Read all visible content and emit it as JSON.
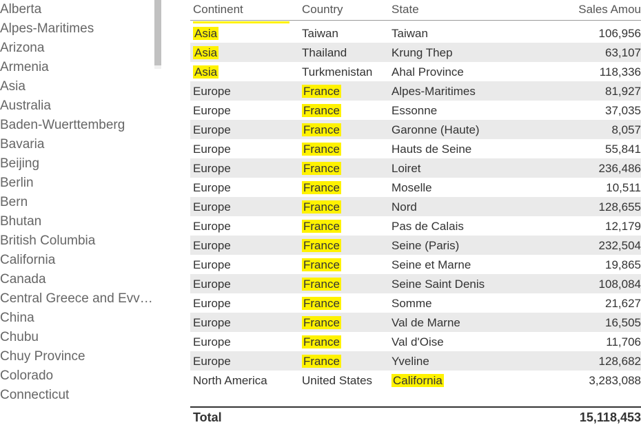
{
  "sidebar": {
    "items": [
      {
        "label": "Alberta"
      },
      {
        "label": "Alpes-Maritimes"
      },
      {
        "label": "Arizona"
      },
      {
        "label": "Armenia"
      },
      {
        "label": "Asia"
      },
      {
        "label": "Australia"
      },
      {
        "label": "Baden-Wuerttemberg"
      },
      {
        "label": "Bavaria"
      },
      {
        "label": "Beijing"
      },
      {
        "label": "Berlin"
      },
      {
        "label": "Bern"
      },
      {
        "label": "Bhutan"
      },
      {
        "label": "British Columbia"
      },
      {
        "label": "California"
      },
      {
        "label": "Canada"
      },
      {
        "label": "Central Greece and Evv…"
      },
      {
        "label": "China"
      },
      {
        "label": "Chubu"
      },
      {
        "label": "Chuy Province"
      },
      {
        "label": "Colorado"
      },
      {
        "label": "Connecticut"
      }
    ]
  },
  "table": {
    "headers": {
      "continent": "Continent",
      "country": "Country",
      "state": "State",
      "amount": "Sales Amou"
    },
    "rows": [
      {
        "continent": "Asia",
        "country": "Taiwan",
        "state": "Taiwan",
        "amount": "106,956",
        "h": "continent"
      },
      {
        "continent": "Asia",
        "country": "Thailand",
        "state": "Krung Thep",
        "amount": "63,107",
        "h": "continent"
      },
      {
        "continent": "Asia",
        "country": "Turkmenistan",
        "state": "Ahal Province",
        "amount": "118,336",
        "h": "continent"
      },
      {
        "continent": "Europe",
        "country": "France",
        "state": "Alpes-Maritimes",
        "amount": "81,927",
        "h": "country"
      },
      {
        "continent": "Europe",
        "country": "France",
        "state": "Essonne",
        "amount": "37,035",
        "h": "country"
      },
      {
        "continent": "Europe",
        "country": "France",
        "state": "Garonne (Haute)",
        "amount": "8,057",
        "h": "country"
      },
      {
        "continent": "Europe",
        "country": "France",
        "state": "Hauts de Seine",
        "amount": "55,841",
        "h": "country"
      },
      {
        "continent": "Europe",
        "country": "France",
        "state": "Loiret",
        "amount": "236,486",
        "h": "country"
      },
      {
        "continent": "Europe",
        "country": "France",
        "state": "Moselle",
        "amount": "10,511",
        "h": "country"
      },
      {
        "continent": "Europe",
        "country": "France",
        "state": "Nord",
        "amount": "128,655",
        "h": "country"
      },
      {
        "continent": "Europe",
        "country": "France",
        "state": "Pas de Calais",
        "amount": "12,179",
        "h": "country"
      },
      {
        "continent": "Europe",
        "country": "France",
        "state": "Seine (Paris)",
        "amount": "232,504",
        "h": "country"
      },
      {
        "continent": "Europe",
        "country": "France",
        "state": "Seine et Marne",
        "amount": "19,865",
        "h": "country"
      },
      {
        "continent": "Europe",
        "country": "France",
        "state": "Seine Saint Denis",
        "amount": "108,084",
        "h": "country"
      },
      {
        "continent": "Europe",
        "country": "France",
        "state": "Somme",
        "amount": "21,627",
        "h": "country"
      },
      {
        "continent": "Europe",
        "country": "France",
        "state": "Val de Marne",
        "amount": "16,505",
        "h": "country"
      },
      {
        "continent": "Europe",
        "country": "France",
        "state": "Val d'Oise",
        "amount": "11,706",
        "h": "country"
      },
      {
        "continent": "Europe",
        "country": "France",
        "state": "Yveline",
        "amount": "128,682",
        "h": "country"
      },
      {
        "continent": "North America",
        "country": "United States",
        "state": "California",
        "amount": "3,283,088",
        "h": "state"
      }
    ],
    "total_label": "Total",
    "total_value": "15,118,453"
  }
}
